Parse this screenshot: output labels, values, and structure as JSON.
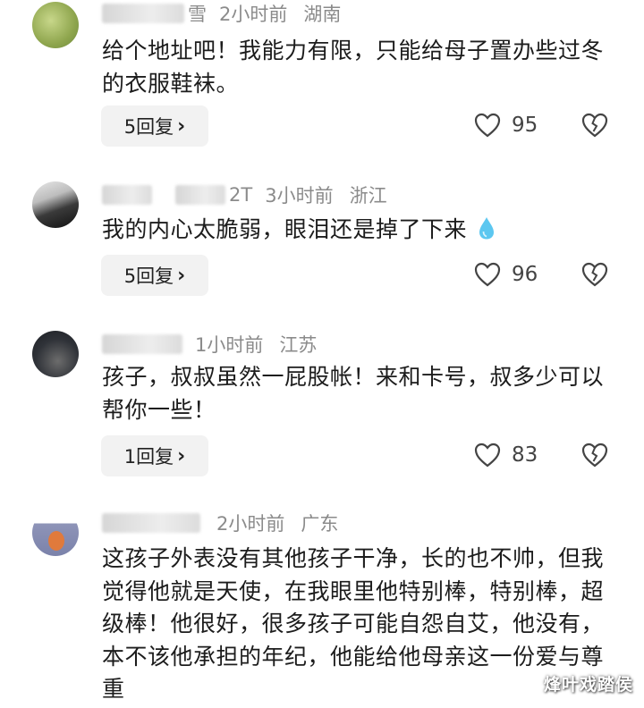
{
  "comments": [
    {
      "name_tail": "雪",
      "time": "2小时前",
      "location": "湖南",
      "text": "给个地址吧！我能力有限，只能给母子置办些过冬的衣服鞋袜。",
      "replies": "5回复",
      "likes": "95"
    },
    {
      "name_tail": "2T",
      "time": "3小时前",
      "location": "浙江",
      "text": "我的内心太脆弱，眼泪还是掉了下来",
      "replies": "5回复",
      "likes": "96"
    },
    {
      "name_tail": "",
      "time": "1小时前",
      "location": "江苏",
      "text": "孩子，叔叔虽然一屁股帐！来和卡号，叔多少可以帮你一些！",
      "replies": "1回复",
      "likes": "83"
    },
    {
      "name_tail": "",
      "time": "2小时前",
      "location": "广东",
      "text": "这孩子外表没有其他孩子干净，长的也不帅，但我觉得他就是天使，在我眼里他特别棒，特别棒，超级棒！他很好，很多孩子可能自怨自艾，他没有，本不该他承担的年纪，他能给他母亲这一份爱与尊重"
    }
  ],
  "icons": {
    "like": "heart-outline-icon",
    "dislike": "broken-heart-icon",
    "emoji": "droplet-emoji"
  },
  "watermark": "烽叶戏踏侯"
}
